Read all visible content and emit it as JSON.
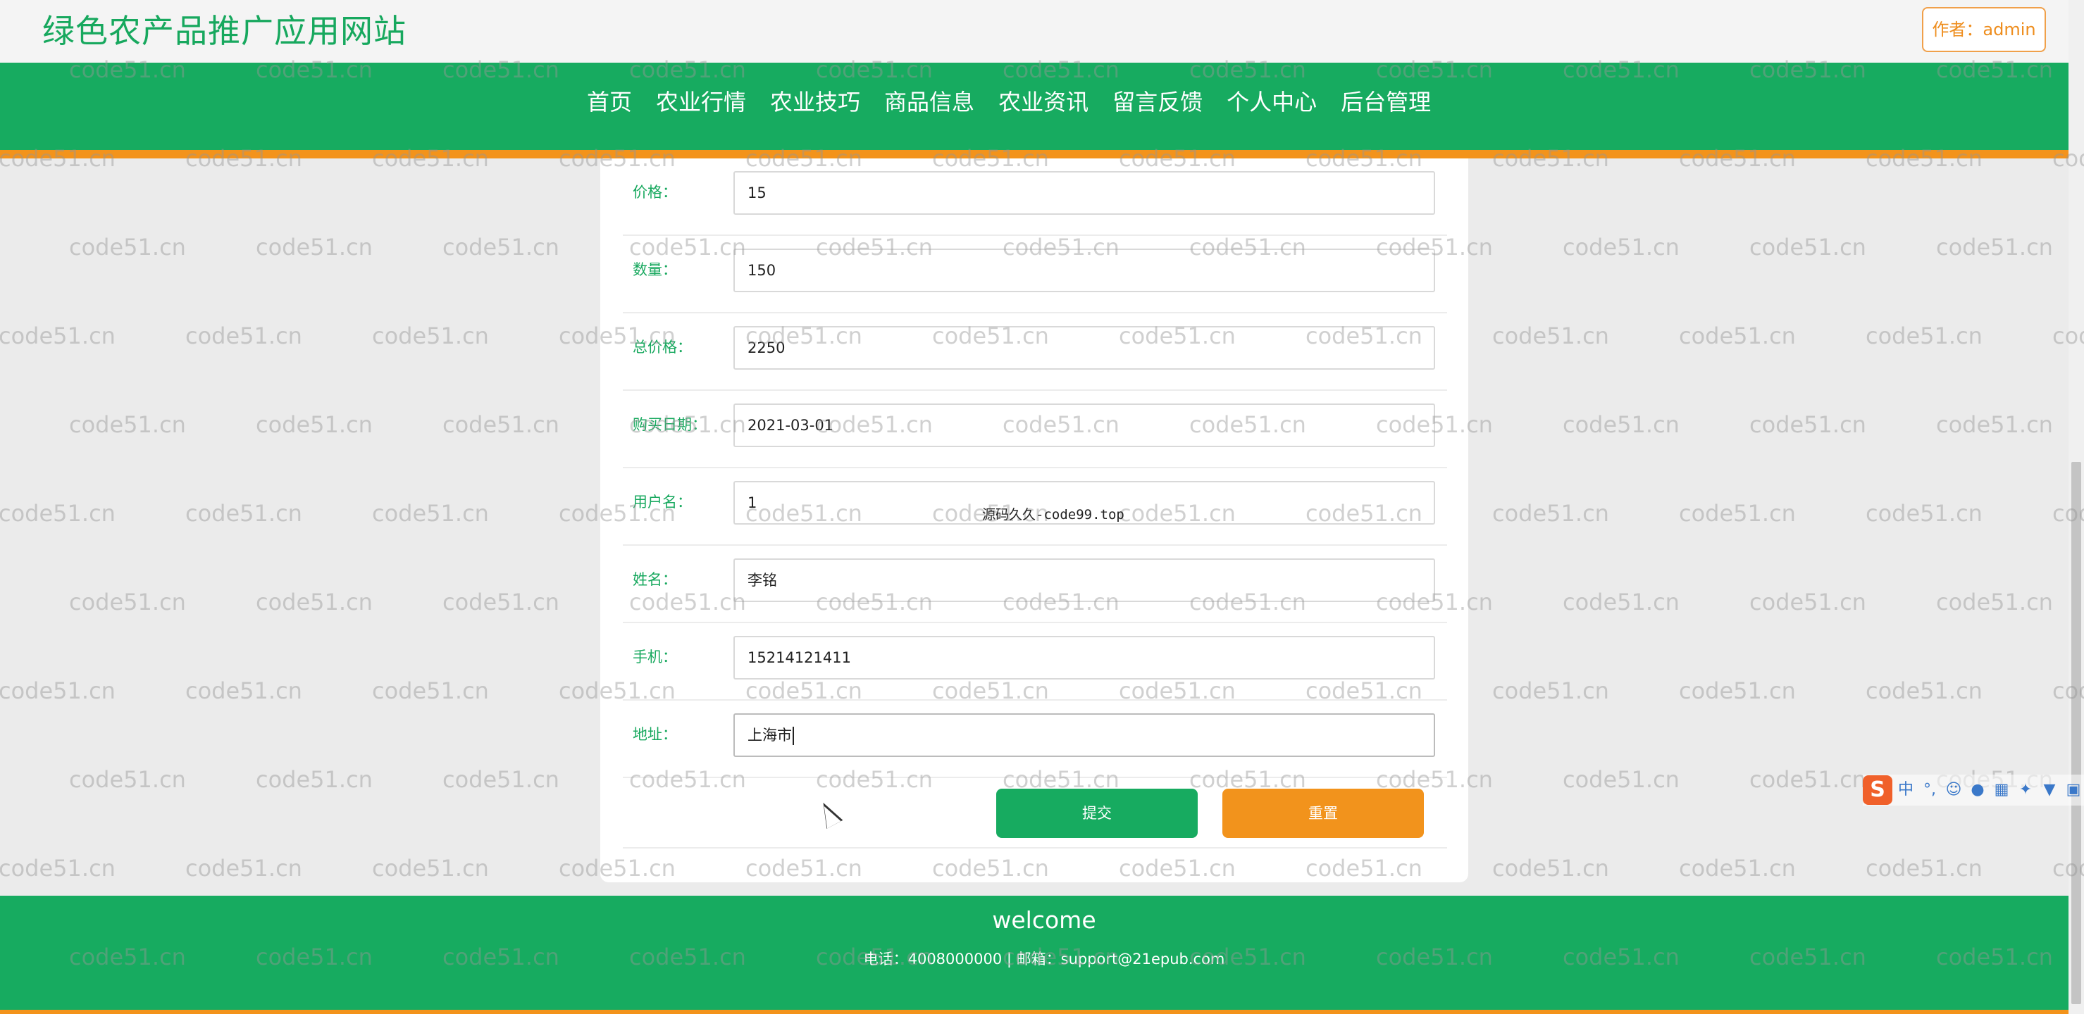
{
  "header": {
    "site_title": "绿色农产品推广应用网站",
    "author_label": "作者：admin"
  },
  "nav": {
    "items": [
      "首页",
      "农业行情",
      "农业技巧",
      "商品信息",
      "农业资讯",
      "留言反馈",
      "个人中心",
      "后台管理"
    ]
  },
  "form": {
    "fields": [
      {
        "label": "价格：",
        "value": "15"
      },
      {
        "label": "数量：",
        "value": "150"
      },
      {
        "label": "总价格：",
        "value": "2250"
      },
      {
        "label": "购买日期：",
        "value": "2021-03-01"
      },
      {
        "label": "用户名：",
        "value": "1"
      },
      {
        "label": "姓名：",
        "value": "李铭"
      },
      {
        "label": "手机：",
        "value": "15214121411"
      },
      {
        "label": "地址：",
        "value": "上海市"
      }
    ],
    "submit_label": "提交",
    "reset_label": "重置"
  },
  "footer": {
    "welcome": "welcome",
    "contact": "电话：4008000000 | 邮箱：support@21epub.com"
  },
  "overlays": {
    "watermark_text": "code51.cn",
    "source_stamp": "源码久久-code99.top",
    "ime_logo": "S",
    "ime_mode": "中"
  },
  "colors": {
    "brand_green": "#17ab60",
    "accent_orange": "#f3931b",
    "label_green": "#17a85e"
  }
}
